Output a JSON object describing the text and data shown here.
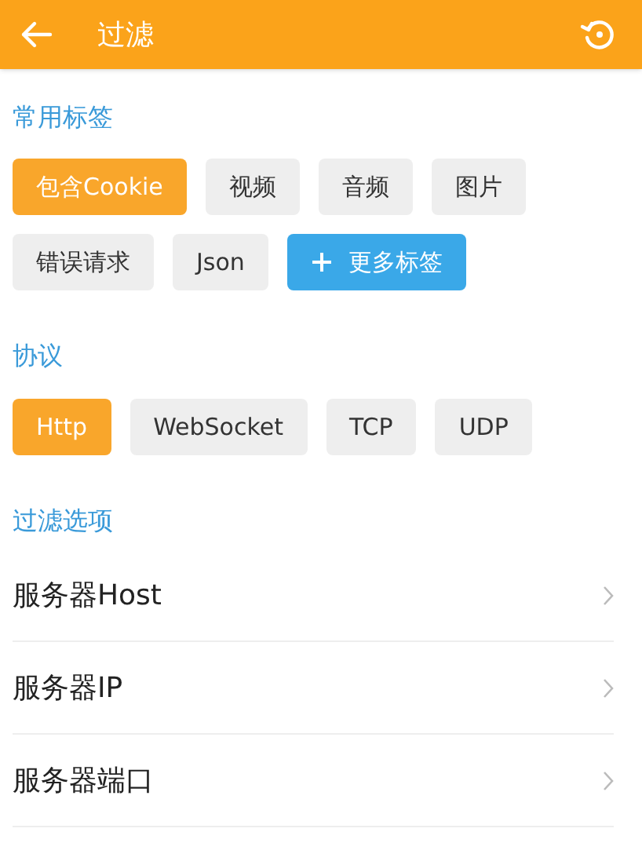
{
  "app_bar": {
    "title": "过滤"
  },
  "common_tags": {
    "title": "常用标签",
    "tags": [
      {
        "label": "包含Cookie",
        "kind": "tag",
        "selected": true
      },
      {
        "label": "视频",
        "kind": "tag",
        "selected": false
      },
      {
        "label": "音频",
        "kind": "tag",
        "selected": false
      },
      {
        "label": "图片",
        "kind": "tag",
        "selected": false
      },
      {
        "label": "错误请求",
        "kind": "tag",
        "selected": false
      },
      {
        "label": "Json",
        "kind": "tag",
        "selected": false
      },
      {
        "label": "更多标签",
        "kind": "more",
        "selected": false
      }
    ]
  },
  "protocol": {
    "title": "协议",
    "options": [
      {
        "label": "Http",
        "selected": true
      },
      {
        "label": "WebSocket",
        "selected": false
      },
      {
        "label": "TCP",
        "selected": false
      },
      {
        "label": "UDP",
        "selected": false
      }
    ]
  },
  "filter_options": {
    "title": "过滤选项",
    "items": [
      {
        "label": "服务器Host"
      },
      {
        "label": "服务器IP"
      },
      {
        "label": "服务器端口"
      }
    ]
  }
}
